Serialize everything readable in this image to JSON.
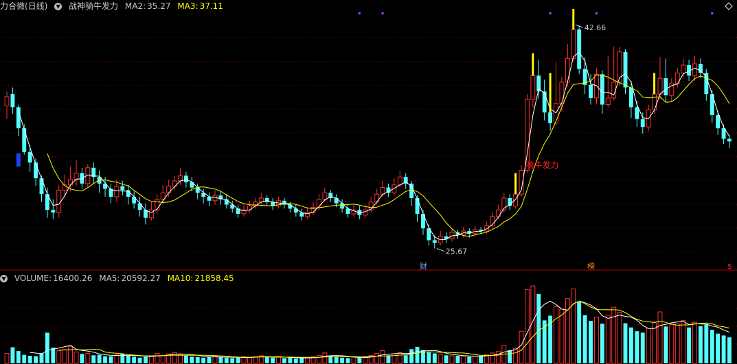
{
  "price_panel": {
    "stock_name": "力合微(日线)",
    "indicator_name": "战神骑牛发力",
    "ma2_label": "MA2:",
    "ma2_value": "35.27",
    "ma3_label": "MA3:",
    "ma3_value": "37.11",
    "high_label": "42.66",
    "low_label": "25.67",
    "signal_label": "骑牛发力",
    "event_marks": [
      "财",
      "榜",
      "$"
    ]
  },
  "volume_panel": {
    "volume_label": "VOLUME:",
    "volume_value": "16400.26",
    "ma5_label": "MA5:",
    "ma5_value": "20592.27",
    "ma10_label": "MA10:",
    "ma10_value": "21858.45"
  },
  "colors": {
    "background": "#000000",
    "up": "#ff3232",
    "down": "#54ffff",
    "grid": "#7a0000",
    "ma_white": "#ffffff",
    "ma_yellow": "#ffff00",
    "signal_red": "#ff2020",
    "event_blue": "#6fa0ff",
    "event_orange": "#ff8a00"
  },
  "chart_data": {
    "type": "candlestick",
    "series": [
      {
        "name": "MA2",
        "description": "white line"
      },
      {
        "name": "MA3",
        "description": "yellow line"
      }
    ],
    "price_annotations": {
      "high": 42.66,
      "low": 25.67
    },
    "candles": [
      [
        36.5,
        37.2,
        37.6,
        35.5
      ],
      [
        37.4,
        36.4,
        37.9,
        35.9
      ],
      [
        36.4,
        34.8,
        36.6,
        34.2
      ],
      [
        34.8,
        33.0,
        35.1,
        32.8
      ],
      [
        33.0,
        32.2,
        33.5,
        31.5
      ],
      [
        32.2,
        31.0,
        32.5,
        30.4
      ],
      [
        31.0,
        29.8,
        31.2,
        29.2
      ],
      [
        29.8,
        28.6,
        30.3,
        28.0
      ],
      [
        28.6,
        28.4,
        29.4,
        27.9
      ],
      [
        28.4,
        30.1,
        30.5,
        28.0
      ],
      [
        30.1,
        30.5,
        31.3,
        29.6
      ],
      [
        30.5,
        30.9,
        31.9,
        30.0
      ],
      [
        30.9,
        31.4,
        32.4,
        30.4
      ],
      [
        31.4,
        30.6,
        31.8,
        30.2
      ],
      [
        30.6,
        31.8,
        32.1,
        30.3
      ],
      [
        31.8,
        31.1,
        32.2,
        30.6
      ],
      [
        31.1,
        30.6,
        31.6,
        29.9
      ],
      [
        30.6,
        30.2,
        31.1,
        29.6
      ],
      [
        30.2,
        29.6,
        30.6,
        29.1
      ],
      [
        29.6,
        30.4,
        30.9,
        29.2
      ],
      [
        30.4,
        30.1,
        30.8,
        29.7
      ],
      [
        30.1,
        29.6,
        30.5,
        29.0
      ],
      [
        29.6,
        29.1,
        30.0,
        28.7
      ],
      [
        29.1,
        28.6,
        29.6,
        28.1
      ],
      [
        28.6,
        28.0,
        29.1,
        27.5
      ],
      [
        28.0,
        28.6,
        29.2,
        27.8
      ],
      [
        28.6,
        29.4,
        29.8,
        28.3
      ],
      [
        29.4,
        29.9,
        30.5,
        29.0
      ],
      [
        29.9,
        30.4,
        30.9,
        29.6
      ],
      [
        30.4,
        30.8,
        31.2,
        30.1
      ],
      [
        30.8,
        31.2,
        31.8,
        30.5
      ],
      [
        31.2,
        30.7,
        31.5,
        30.3
      ],
      [
        30.7,
        30.3,
        31.1,
        30.0
      ],
      [
        30.3,
        29.9,
        30.6,
        29.4
      ],
      [
        29.9,
        29.6,
        30.2,
        29.1
      ],
      [
        29.6,
        29.3,
        29.9,
        28.9
      ],
      [
        29.3,
        29.7,
        30.1,
        29.0
      ],
      [
        29.7,
        29.4,
        30.0,
        29.0
      ],
      [
        29.4,
        29.0,
        29.8,
        28.7
      ],
      [
        29.0,
        28.7,
        29.3,
        28.4
      ],
      [
        28.7,
        28.3,
        29.0,
        28.0
      ],
      [
        28.3,
        28.6,
        29.0,
        28.1
      ],
      [
        28.6,
        28.9,
        29.3,
        28.4
      ],
      [
        28.9,
        29.2,
        29.5,
        28.7
      ],
      [
        29.2,
        29.5,
        29.9,
        29.0
      ],
      [
        29.5,
        29.2,
        29.7,
        28.9
      ],
      [
        29.2,
        28.9,
        29.5,
        28.6
      ],
      [
        28.9,
        29.3,
        29.6,
        28.7
      ],
      [
        29.3,
        29.0,
        29.5,
        28.7
      ],
      [
        29.0,
        28.7,
        29.2,
        28.4
      ],
      [
        28.7,
        28.4,
        29.0,
        28.1
      ],
      [
        28.4,
        28.1,
        28.7,
        27.8
      ],
      [
        28.1,
        28.4,
        28.8,
        27.9
      ],
      [
        28.4,
        28.8,
        29.2,
        28.2
      ],
      [
        28.8,
        29.4,
        29.8,
        28.6
      ],
      [
        29.4,
        29.9,
        30.3,
        29.2
      ],
      [
        29.9,
        29.5,
        30.1,
        29.2
      ],
      [
        29.5,
        29.1,
        29.8,
        28.8
      ],
      [
        29.1,
        28.7,
        29.4,
        28.4
      ],
      [
        28.7,
        28.3,
        29.0,
        28.0
      ],
      [
        28.3,
        28.6,
        29.0,
        28.1
      ],
      [
        28.6,
        28.2,
        28.9,
        27.9
      ],
      [
        28.2,
        28.6,
        29.0,
        28.0
      ],
      [
        28.6,
        29.2,
        29.6,
        28.4
      ],
      [
        29.2,
        29.8,
        30.2,
        29.0
      ],
      [
        29.8,
        30.3,
        30.8,
        29.6
      ],
      [
        30.3,
        29.9,
        30.6,
        29.6
      ],
      [
        29.9,
        30.5,
        31.0,
        29.7
      ],
      [
        30.5,
        31.1,
        31.6,
        30.3
      ],
      [
        31.1,
        30.6,
        31.4,
        30.2
      ],
      [
        30.6,
        29.5,
        30.8,
        28.9
      ],
      [
        29.5,
        28.3,
        29.7,
        27.7
      ],
      [
        28.3,
        27.2,
        28.6,
        26.7
      ],
      [
        27.2,
        26.3,
        27.5,
        25.9
      ],
      [
        26.3,
        26.1,
        26.7,
        25.67
      ],
      [
        26.1,
        26.6,
        27.0,
        25.9
      ],
      [
        26.6,
        26.4,
        26.9,
        26.1
      ],
      [
        26.4,
        26.9,
        27.2,
        26.2
      ],
      [
        26.9,
        26.7,
        27.1,
        26.4
      ],
      [
        26.7,
        27.0,
        27.3,
        26.5
      ],
      [
        27.0,
        26.8,
        27.2,
        26.5
      ],
      [
        26.8,
        27.1,
        27.4,
        26.6
      ],
      [
        27.1,
        27.0,
        27.3,
        26.8
      ],
      [
        27.0,
        27.4,
        27.7,
        26.8
      ],
      [
        27.4,
        28.1,
        28.4,
        27.2
      ],
      [
        28.1,
        28.6,
        29.0,
        27.9
      ],
      [
        28.6,
        29.5,
        29.9,
        28.4
      ],
      [
        29.5,
        28.9,
        29.8,
        28.6
      ],
      [
        28.9,
        29.8,
        30.2,
        28.7
      ],
      [
        29.8,
        31.6,
        32.0,
        29.6
      ],
      [
        31.6,
        37.0,
        37.4,
        31.4
      ],
      [
        37.0,
        38.8,
        39.3,
        36.4
      ],
      [
        38.8,
        37.6,
        40.0,
        37.0
      ],
      [
        37.6,
        36.0,
        38.5,
        35.4
      ],
      [
        36.0,
        35.2,
        37.8,
        34.6
      ],
      [
        35.2,
        36.7,
        39.8,
        35.0
      ],
      [
        36.7,
        38.3,
        38.7,
        36.1
      ],
      [
        38.3,
        40.1,
        41.2,
        38.0
      ],
      [
        40.1,
        42.3,
        42.66,
        39.9
      ],
      [
        42.3,
        39.3,
        42.6,
        38.9
      ],
      [
        39.3,
        38.1,
        40.2,
        37.4
      ],
      [
        38.1,
        37.1,
        38.9,
        36.6
      ],
      [
        37.1,
        38.9,
        39.4,
        36.6
      ],
      [
        38.9,
        36.6,
        39.2,
        35.9
      ],
      [
        36.6,
        37.1,
        40.3,
        36.4
      ],
      [
        37.1,
        38.3,
        41.0,
        36.9
      ],
      [
        38.3,
        40.6,
        41.0,
        38.0
      ],
      [
        40.6,
        37.9,
        40.8,
        37.4
      ],
      [
        37.9,
        36.4,
        38.4,
        35.6
      ],
      [
        36.4,
        35.5,
        36.9,
        34.9
      ],
      [
        35.5,
        34.9,
        36.0,
        34.4
      ],
      [
        34.9,
        36.2,
        36.6,
        34.6
      ],
      [
        36.2,
        37.4,
        37.8,
        35.9
      ],
      [
        37.4,
        38.6,
        40.2,
        37.0
      ],
      [
        38.6,
        37.3,
        40.1,
        36.8
      ],
      [
        37.3,
        38.2,
        38.6,
        36.8
      ],
      [
        38.2,
        39.0,
        39.4,
        37.9
      ],
      [
        39.0,
        39.6,
        40.1,
        38.7
      ],
      [
        39.6,
        38.8,
        40.0,
        38.4
      ],
      [
        38.8,
        39.7,
        40.3,
        38.4
      ],
      [
        39.7,
        39.0,
        40.1,
        38.6
      ],
      [
        39.0,
        37.4,
        39.3,
        36.9
      ],
      [
        37.4,
        35.8,
        37.7,
        35.2
      ],
      [
        35.8,
        34.8,
        36.1,
        34.3
      ],
      [
        34.8,
        34.0,
        35.1,
        33.6
      ],
      [
        34.0,
        33.8,
        34.3,
        33.3
      ]
    ],
    "ma2_line": {
      "name": "MA2",
      "color": "white"
    },
    "ma3_line": {
      "name": "MA3",
      "color": "yellow"
    },
    "volume": [
      2100,
      3400,
      2600,
      1800,
      1600,
      1500,
      2200,
      6500,
      3300,
      2700,
      2900,
      3600,
      2400,
      2000,
      2100,
      1700,
      1800,
      1500,
      1500,
      1800,
      2000,
      1600,
      1400,
      1200,
      1400,
      1600,
      2100,
      1700,
      2000,
      2300,
      1900,
      1600,
      1400,
      1300,
      1200,
      1400,
      1500,
      1300,
      1200,
      1100,
      1200,
      1400,
      1300,
      1500,
      1600,
      1300,
      1200,
      1400,
      1100,
      1200,
      1000,
      1100,
      1200,
      1400,
      1700,
      2200,
      1600,
      1400,
      1200,
      1100,
      1300,
      1200,
      1300,
      1700,
      2100,
      2700,
      1700,
      2000,
      2300,
      1700,
      3000,
      3500,
      2800,
      2300,
      2100,
      1800,
      1700,
      1600,
      1600,
      1500,
      1400,
      1500,
      1600,
      1800,
      2200,
      2500,
      3800,
      2800,
      3200,
      6800,
      15600,
      16400,
      14700,
      9100,
      10100,
      12000,
      11500,
      13700,
      15800,
      13000,
      10200,
      9000,
      9800,
      8400,
      10200,
      11900,
      10800,
      8500,
      7600,
      6800,
      6500,
      7400,
      8600,
      10900,
      7800,
      8200,
      8400,
      9100,
      7600,
      8700,
      7900,
      8200,
      7100,
      6300,
      5900,
      5500
    ],
    "volume_ma": [
      {
        "name": "MA5",
        "color": "white"
      },
      {
        "name": "MA10",
        "color": "yellow"
      }
    ]
  }
}
